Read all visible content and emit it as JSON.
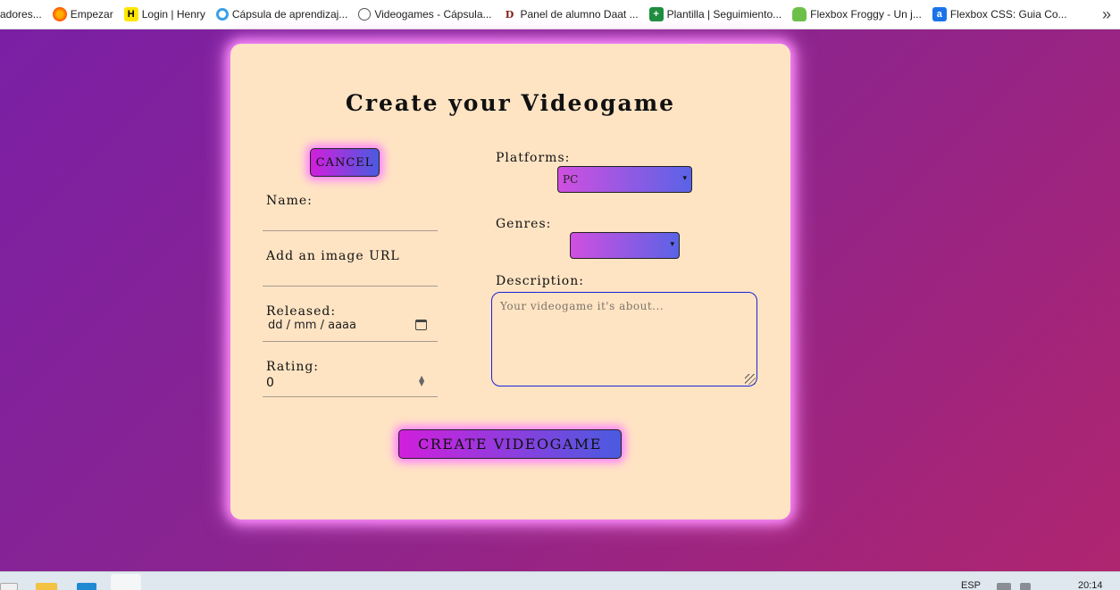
{
  "bookmarks": {
    "items": [
      {
        "label": "adores...",
        "icon": "folder-icon"
      },
      {
        "label": "Empezar",
        "icon": "firefox-icon"
      },
      {
        "label": "Login | Henry",
        "icon": "henry-icon"
      },
      {
        "label": "Cápsula de aprendizaj...",
        "icon": "circle-icon"
      },
      {
        "label": "Videogames - Cápsula...",
        "icon": "globe-icon"
      },
      {
        "label": "Panel de alumno Daat ...",
        "icon": "daat-icon"
      },
      {
        "label": "Plantilla | Seguimiento...",
        "icon": "sheets-icon"
      },
      {
        "label": "Flexbox Froggy - Un j...",
        "icon": "frog-icon"
      },
      {
        "label": "Flexbox CSS: Guia Co...",
        "icon": "guide-icon"
      }
    ],
    "more_icon": "chevrons-right-icon"
  },
  "form": {
    "title": "Create your Videogame",
    "cancel_label": "CANCEL",
    "name_label": "Name:",
    "name_value": "",
    "image_label": "Add an image URL",
    "image_value": "",
    "released_label": "Released:",
    "released_placeholder": "dd / mm / aaaa",
    "rating_label": "Rating:",
    "rating_value": "0",
    "platforms_label": "Platforms:",
    "platforms_selected": "PC",
    "genres_label": "Genres:",
    "genres_selected": "",
    "description_label": "Description:",
    "description_placeholder": "Your videogame it's about...",
    "submit_label": "CREATE VIDEOGAME"
  },
  "taskbar": {
    "language": "ESP",
    "time": "20:14"
  },
  "colors": {
    "background_start": "#7a1fa6",
    "background_end": "#b0256f",
    "card": "#ffe4c4",
    "button_gradient_start": "#d21fdc",
    "button_gradient_end": "#4a5be0",
    "glow": "#ff7dff",
    "textarea_border": "#1a22d8"
  }
}
